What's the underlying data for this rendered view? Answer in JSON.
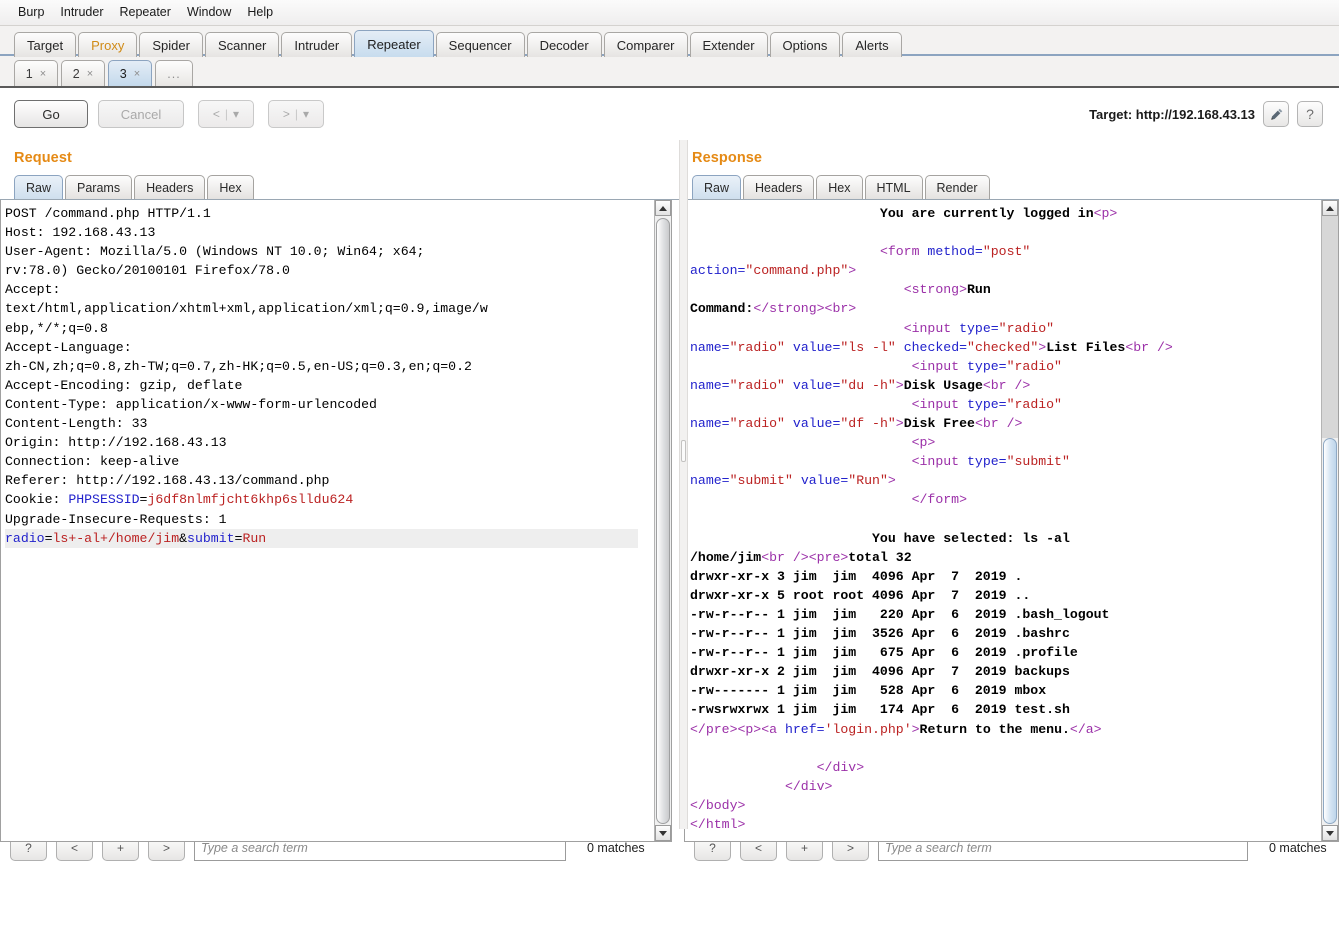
{
  "menu": {
    "items": [
      "Burp",
      "Intruder",
      "Repeater",
      "Window",
      "Help"
    ]
  },
  "main_tabs": [
    {
      "label": "Target",
      "active": false
    },
    {
      "label": "Proxy",
      "active": false
    },
    {
      "label": "Spider",
      "active": false
    },
    {
      "label": "Scanner",
      "active": false
    },
    {
      "label": "Intruder",
      "active": false
    },
    {
      "label": "Repeater",
      "active": true
    },
    {
      "label": "Sequencer",
      "active": false
    },
    {
      "label": "Decoder",
      "active": false
    },
    {
      "label": "Comparer",
      "active": false
    },
    {
      "label": "Extender",
      "active": false
    },
    {
      "label": "Options",
      "active": false
    },
    {
      "label": "Alerts",
      "active": false
    }
  ],
  "repeater_tabs": [
    {
      "label": "1",
      "close": "×",
      "active": false
    },
    {
      "label": "2",
      "close": "×",
      "active": false
    },
    {
      "label": "3",
      "close": "×",
      "active": true
    },
    {
      "label": "...",
      "close": "",
      "active": false
    }
  ],
  "actions": {
    "go_label": "Go",
    "cancel_label": "Cancel",
    "back_label": "<",
    "back_caret": "▾",
    "forward_label": ">",
    "forward_caret": "▾",
    "separator": "|"
  },
  "target": {
    "label": "Target: http://192.168.43.13",
    "edit_icon": "pencil-icon",
    "help_label": "?"
  },
  "request": {
    "title": "Request",
    "tabs": [
      {
        "label": "Raw",
        "active": true
      },
      {
        "label": "Params",
        "active": false
      },
      {
        "label": "Headers",
        "active": false
      },
      {
        "label": "Hex",
        "active": false
      }
    ],
    "headers_text": "POST /command.php HTTP/1.1\nHost: 192.168.43.13\nUser-Agent: Mozilla/5.0 (Windows NT 10.0; Win64; x64;\nrv:78.0) Gecko/20100101 Firefox/78.0\nAccept:\ntext/html,application/xhtml+xml,application/xml;q=0.9,image/w\nebp,*/*;q=0.8\nAccept-Language:\nzh-CN,zh;q=0.8,zh-TW;q=0.7,zh-HK;q=0.5,en-US;q=0.3,en;q=0.2\nAccept-Encoding: gzip, deflate\nContent-Type: application/x-www-form-urlencoded\nContent-Length: 33\nOrigin: http://192.168.43.13\nConnection: keep-alive\nReferer: http://192.168.43.13/command.php",
    "cookie_label": "Cookie: ",
    "cookie_name": "PHPSESSID",
    "cookie_eq": "=",
    "cookie_value": "j6df8nlmfjcht6khp6slldu624",
    "upgrade_line": "Upgrade-Insecure-Requests: 1",
    "body": {
      "p1_name": "radio",
      "p1_eq": "=",
      "p1_value": "ls+-al+/home/jim",
      "amp": "&",
      "p2_name": "submit",
      "p2_eq": "=",
      "p2_value": "Run"
    }
  },
  "response": {
    "title": "Response",
    "tabs": [
      {
        "label": "Raw",
        "active": true
      },
      {
        "label": "Headers",
        "active": false
      },
      {
        "label": "Hex",
        "active": false
      },
      {
        "label": "HTML",
        "active": false
      },
      {
        "label": "Render",
        "active": false
      }
    ],
    "line_logged_in_text": "                        You are currently logged in",
    "line_logged_in_tag": "<p>",
    "form_indent": "                        ",
    "form_open_tag": "<form ",
    "form_attr_method": "method=",
    "form_val_post": "\"post\"",
    "form_attr_action": "action=",
    "form_val_action": "\"command.php\"",
    "form_close_bracket": ">",
    "strong_indent": "                           ",
    "strong_open": "<strong>",
    "strong_text_1": "Run",
    "strong_text_2": "Command:",
    "strong_close": "</strong>",
    "br_tag": "<br>",
    "radio1": {
      "indent": "                           ",
      "tag": "<input ",
      "attr_type": "type=",
      "val_type": "\"radio\"",
      "attr_name": "name=",
      "val_name": "\"radio\"",
      "attr_value": "value=",
      "val_value": "\"ls -l\"",
      "attr_checked": "checked=",
      "val_checked": "\"checked\"",
      "close": ">",
      "text": "List Files",
      "br": "<br />"
    },
    "radio2": {
      "indent": "                            ",
      "tag": "<input ",
      "attr_type": "type=",
      "val_type": "\"radio\"",
      "attr_name": "name=",
      "val_name": "\"radio\"",
      "attr_value": "value=",
      "val_value": "\"du -h\"",
      "close": ">",
      "text": "Disk Usage",
      "br": "<br />"
    },
    "radio3": {
      "indent": "                            ",
      "tag": "<input ",
      "attr_type": "type=",
      "val_type": "\"radio\"",
      "attr_name": "name=",
      "val_name": "\"radio\"",
      "attr_value": "value=",
      "val_value": "\"df -h\"",
      "close": ">",
      "text": "Disk Free",
      "br": "<br />"
    },
    "p_tag": "<p>",
    "submit": {
      "indent": "                            ",
      "tag": "<input ",
      "attr_type": "type=",
      "val_type": "\"submit\"",
      "attr_name": "name=",
      "val_name": "\"submit\"",
      "attr_value": "value=",
      "val_value": "\"Run\"",
      "close": ">"
    },
    "form_close": "</form>",
    "selected_line": "                       You have selected: ls -al",
    "home_path": "/home/jim",
    "br_self": "<br />",
    "pre_open": "<pre>",
    "total_line": "total 32",
    "listing": [
      "drwxr-xr-x 3 jim  jim  4096 Apr  7  2019 .",
      "drwxr-xr-x 5 root root 4096 Apr  7  2019 ..",
      "-rw-r--r-- 1 jim  jim   220 Apr  6  2019 .bash_logout",
      "-rw-r--r-- 1 jim  jim  3526 Apr  6  2019 .bashrc",
      "-rw-r--r-- 1 jim  jim   675 Apr  6  2019 .profile",
      "drwxr-xr-x 2 jim  jim  4096 Apr  7  2019 backups",
      "-rw------- 1 jim  jim   528 Apr  6  2019 mbox",
      "-rwsrwxrwx 1 jim  jim   174 Apr  6  2019 test.sh"
    ],
    "pre_close": "</pre>",
    "p_open": "<p>",
    "a_open": "<a ",
    "a_attr_href": "href=",
    "a_val_href": "'login.php'",
    "a_close_bracket": ">",
    "a_text": "Return to the menu.",
    "a_close": "</a>",
    "div_close_1": "                </div>",
    "div_close_2": "            </div>",
    "body_close": "</body>",
    "html_close": "</html>"
  },
  "search_bars": {
    "help_label": "?",
    "prev_label": "<",
    "add_label": "+",
    "next_label": ">",
    "placeholder": "Type a search term",
    "value": "",
    "matches_left": "0 matches",
    "matches_right": "0 matches"
  },
  "colors": {
    "accent_orange": "#e58a15",
    "tab_active_blue": "#cfdfee",
    "tag_purple": "#9b30a8",
    "attr_blue": "#2222cc",
    "value_red": "#bb2222"
  }
}
